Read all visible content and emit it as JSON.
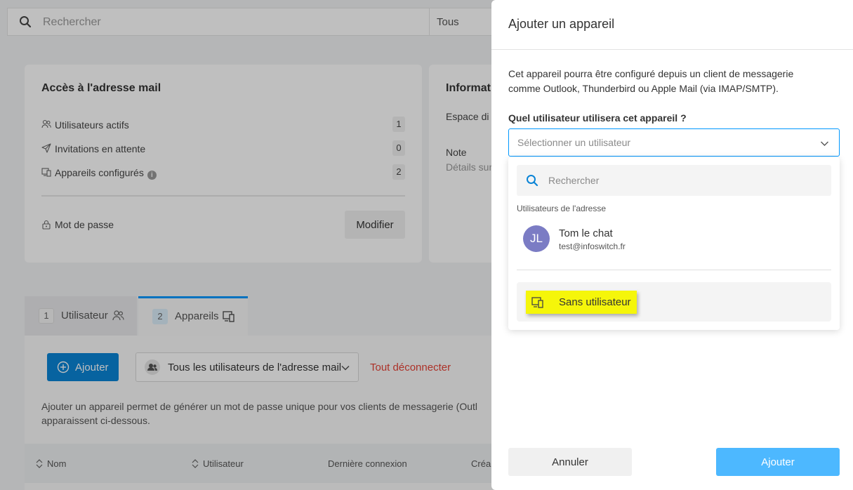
{
  "search": {
    "placeholder": "Rechercher",
    "filter_value": "Tous"
  },
  "access_card": {
    "title": "Accès à l'adresse mail",
    "rows": [
      {
        "label": "Utilisateurs actifs",
        "count": "1",
        "icon": "users-icon"
      },
      {
        "label": "Invitations en attente",
        "count": "0",
        "icon": "send-icon"
      },
      {
        "label": "Appareils configurés",
        "count": "2",
        "icon": "devices-icon",
        "info": "i"
      }
    ],
    "password_label": "Mot de passe",
    "modify_label": "Modifier"
  },
  "info_card": {
    "title": "Informat",
    "space_label": "Espace di",
    "note_label": "Note",
    "note_sub": "Détails sur"
  },
  "tabs": [
    {
      "num": "1",
      "label": "Utilisateur"
    },
    {
      "num": "2",
      "label": "Appareils"
    }
  ],
  "devices_panel": {
    "add_label": "Ajouter",
    "user_filter": "Tous les utilisateurs de l'adresse mail",
    "disconnect_label": "Tout déconnecter",
    "description": "Ajouter un appareil permet de générer un mot de passe unique pour vos clients de messagerie (Outl apparaissent ci-dessous.",
    "columns": [
      "Nom",
      "Utilisateur",
      "Dernière connexion",
      "Créa"
    ]
  },
  "drawer": {
    "title": "Ajouter un appareil",
    "description": "Cet appareil pourra être configuré depuis un client de messagerie comme Outlook, Thunderbird ou Apple Mail (via IMAP/SMTP).",
    "field_label": "Quel utilisateur utilisera cet appareil ?",
    "select_placeholder": "Sélectionner un utilisateur",
    "dropdown": {
      "search_placeholder": "Rechercher",
      "group_label": "Utilisateurs de l'adresse",
      "users": [
        {
          "initials": "JL",
          "name": "Tom le chat",
          "email": "test@infoswitch.fr"
        }
      ],
      "none_option": "Sans utilisateur"
    },
    "cancel_label": "Annuler",
    "submit_label": "Ajouter"
  },
  "colors": {
    "accent": "#0098ff",
    "primary_button": "#0a84d6",
    "submit_disabled": "#4db8ff",
    "danger": "#e64236",
    "avatar": "#7b7cc4",
    "highlight": "#f5f60a"
  }
}
